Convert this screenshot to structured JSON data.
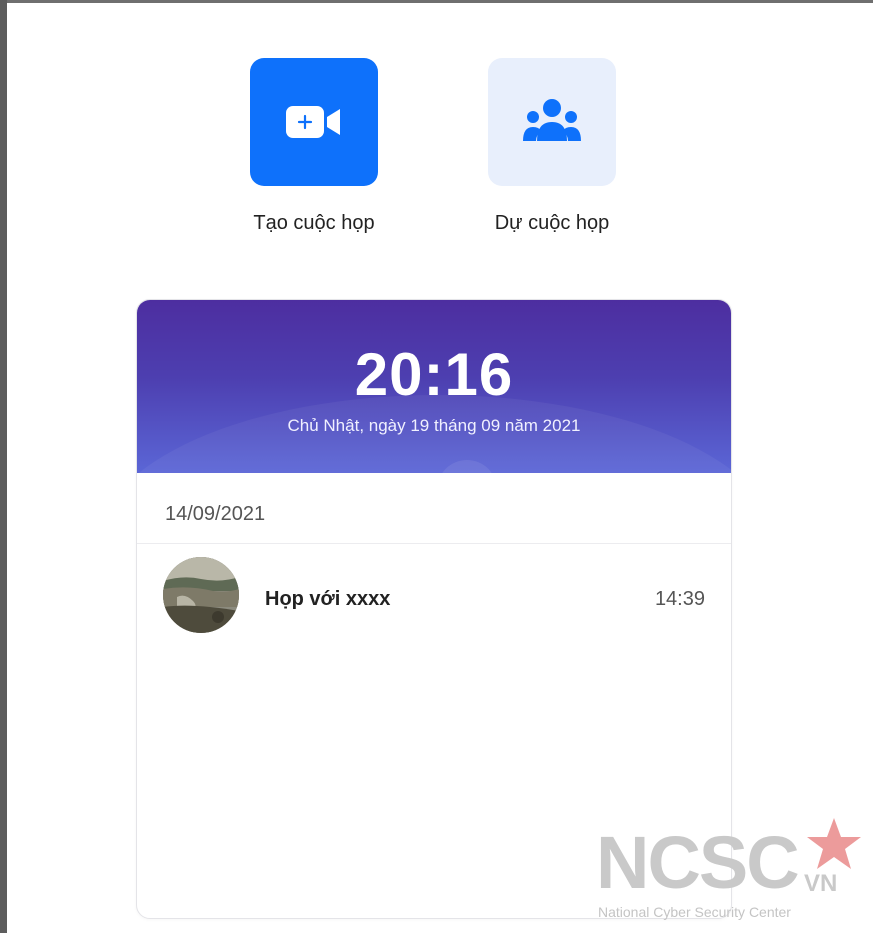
{
  "actions": {
    "create_label": "Tạo cuộc họp",
    "join_label": "Dự cuộc họp",
    "create_icon": "video-camera-plus-icon",
    "join_icon": "people-group-icon"
  },
  "clock": {
    "time": "20:16",
    "date": "Chủ Nhật, ngày 19 tháng 09 năm 2021"
  },
  "meetings": {
    "date_header": "14/09/2021",
    "items": [
      {
        "title": "Họp với xxxx",
        "time": "14:39",
        "avatar": "landscape-photo"
      }
    ]
  },
  "watermark": {
    "logo": "NCSC",
    "suffix": "VN",
    "subtitle": "National Cyber Security Center"
  },
  "colors": {
    "primary": "#0e71fb",
    "secondary_bg": "#e8effc",
    "header_start": "#4d2ea0",
    "header_end": "#5b66d6",
    "watermark_star": "#e98a8a"
  }
}
